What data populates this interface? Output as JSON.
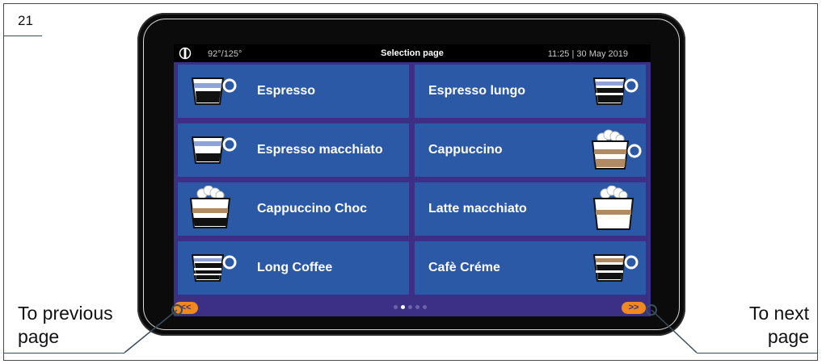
{
  "page_number": "21",
  "callouts": {
    "previous": [
      "To previous",
      "page"
    ],
    "next": [
      "To next",
      "page"
    ]
  },
  "screen": {
    "status": {
      "temperature": "92°/125°",
      "title": "Selection page",
      "datetime": "11:25 | 30 May 2019",
      "icon": "power-indicator-icon"
    },
    "tiles": [
      {
        "label": "Espresso",
        "icon": "espresso-cup-icon"
      },
      {
        "label": "Espresso lungo",
        "icon": "espresso-lungo-cup-icon"
      },
      {
        "label": "Espresso macchiato",
        "icon": "espresso-macchiato-cup-icon"
      },
      {
        "label": "Cappuccino",
        "icon": "cappuccino-cup-icon"
      },
      {
        "label": "Cappuccino Choc",
        "icon": "cappuccino-choc-cup-icon"
      },
      {
        "label": "Latte macchiato",
        "icon": "latte-macchiato-cup-icon"
      },
      {
        "label": "Long Coffee",
        "icon": "long-coffee-cup-icon"
      },
      {
        "label": "Cafè Créme",
        "icon": "cafe-creme-cup-icon"
      }
    ],
    "nav": {
      "previous": "<<",
      "next": ">>"
    },
    "pager": {
      "pages": 5,
      "active_page": 2
    }
  },
  "colors": {
    "tile": "#2b59a6",
    "background": "#3b2f86",
    "nav_button": "#f08a1e"
  }
}
